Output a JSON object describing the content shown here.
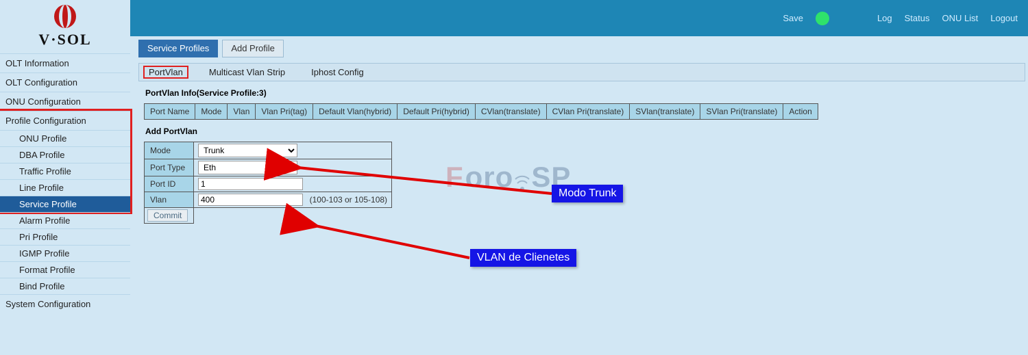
{
  "brand": "V·SOL",
  "topbar": {
    "save": "Save",
    "links": {
      "log": "Log",
      "status": "Status",
      "onulist": "ONU List",
      "logout": "Logout"
    }
  },
  "sidebar": {
    "olt_info": "OLT Information",
    "olt_config": "OLT Configuration",
    "onu_config": "ONU Configuration",
    "profile_config": "Profile Configuration",
    "subs": {
      "onu": "ONU Profile",
      "dba": "DBA Profile",
      "traffic": "Traffic Profile",
      "line": "Line Profile",
      "service": "Service Profile",
      "alarm": "Alarm Profile",
      "pri": "Pri Profile",
      "igmp": "IGMP Profile",
      "format": "Format Profile",
      "bind": "Bind Profile"
    },
    "system_config": "System Configuration"
  },
  "tabs1": {
    "service_profiles": "Service Profiles",
    "add_profile": "Add Profile"
  },
  "tabs2": {
    "portvlan": "PortVlan",
    "mcast": "Multicast Vlan Strip",
    "iphost": "Iphost Config"
  },
  "info": {
    "title": "PortVlan Info(Service Profile:3)",
    "headers": [
      "Port Name",
      "Mode",
      "Vlan",
      "Vlan Pri(tag)",
      "Default Vlan(hybrid)",
      "Default Pri(hybrid)",
      "CVlan(translate)",
      "CVlan Pri(translate)",
      "SVlan(translate)",
      "SVlan Pri(translate)",
      "Action"
    ]
  },
  "form": {
    "title": "Add PortVlan",
    "mode_label": "Mode",
    "mode_value": "Trunk",
    "porttype_label": "Port Type",
    "porttype_value": "Eth",
    "portid_label": "Port ID",
    "portid_value": "1",
    "vlan_label": "Vlan",
    "vlan_value": "400",
    "vlan_hint": "(100-103 or 105-108)",
    "commit": "Commit"
  },
  "annotations": {
    "trunk": "Modo Trunk",
    "vlan": "VLAN de Clienetes"
  }
}
